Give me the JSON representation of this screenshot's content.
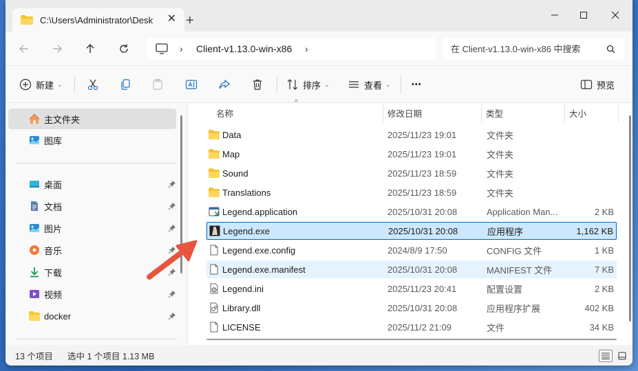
{
  "window": {
    "tab_title": "C:\\Users\\Administrator\\Desktop",
    "tab_close": "✕",
    "new_tab": "+"
  },
  "address": {
    "breadcrumb": [
      "Client-v1.13.0-win-x86"
    ],
    "search_placeholder": "在 Client-v1.13.0-win-x86 中搜索"
  },
  "toolbar": {
    "new_label": "新建",
    "sort_label": "排序",
    "view_label": "查看",
    "more_label": "•••",
    "preview_label": "预览"
  },
  "sidebar": {
    "top_items": [
      {
        "label": "主文件夹",
        "icon": "home-icon"
      },
      {
        "label": "图库",
        "icon": "gallery-icon"
      }
    ],
    "pinned_items": [
      {
        "label": "桌面",
        "icon": "desktop-icon"
      },
      {
        "label": "文档",
        "icon": "documents-icon"
      },
      {
        "label": "图片",
        "icon": "pictures-icon"
      },
      {
        "label": "音乐",
        "icon": "music-icon"
      },
      {
        "label": "下载",
        "icon": "downloads-icon"
      },
      {
        "label": "视频",
        "icon": "videos-icon"
      },
      {
        "label": "docker",
        "icon": "folder-icon"
      }
    ]
  },
  "columns": {
    "name": "名称",
    "date": "修改日期",
    "type": "类型",
    "size": "大小"
  },
  "files": [
    {
      "name": "Data",
      "date": "2025/11/23 19:01",
      "type": "文件夹",
      "size": "",
      "icon": "folder-icon"
    },
    {
      "name": "Map",
      "date": "2025/11/23 19:01",
      "type": "文件夹",
      "size": "",
      "icon": "folder-icon"
    },
    {
      "name": "Sound",
      "date": "2025/11/23 18:59",
      "type": "文件夹",
      "size": "",
      "icon": "folder-icon"
    },
    {
      "name": "Translations",
      "date": "2025/11/23 18:59",
      "type": "文件夹",
      "size": "",
      "icon": "folder-icon"
    },
    {
      "name": "Legend.application",
      "date": "2025/10/31 20:08",
      "type": "Application Man...",
      "size": "2 KB",
      "icon": "application-manifest-icon"
    },
    {
      "name": "Legend.exe",
      "date": "2025/10/31 20:08",
      "type": "应用程序",
      "size": "1,162 KB",
      "icon": "exe-icon",
      "selected": true
    },
    {
      "name": "Legend.exe.config",
      "date": "2024/8/9 17:50",
      "type": "CONFIG 文件",
      "size": "1 KB",
      "icon": "file-icon"
    },
    {
      "name": "Legend.exe.manifest",
      "date": "2025/10/31 20:08",
      "type": "MANIFEST 文件",
      "size": "7 KB",
      "icon": "file-icon",
      "hover": true
    },
    {
      "name": "Legend.ini",
      "date": "2025/11/23 20:41",
      "type": "配置设置",
      "size": "2 KB",
      "icon": "ini-settings-icon"
    },
    {
      "name": "Library.dll",
      "date": "2025/10/31 20:08",
      "type": "应用程序扩展",
      "size": "402 KB",
      "icon": "dll-icon"
    },
    {
      "name": "LICENSE",
      "date": "2025/11/2 21:09",
      "type": "文件",
      "size": "34 KB",
      "icon": "file-icon"
    }
  ],
  "status": {
    "count": "13 个项目",
    "selection": "选中 1 个项目  1.13 MB"
  },
  "colors": {
    "accent": "#0067c0",
    "selection_bg": "#cce8ff",
    "folder": "#f4c430",
    "arrow": "#e8553e"
  }
}
